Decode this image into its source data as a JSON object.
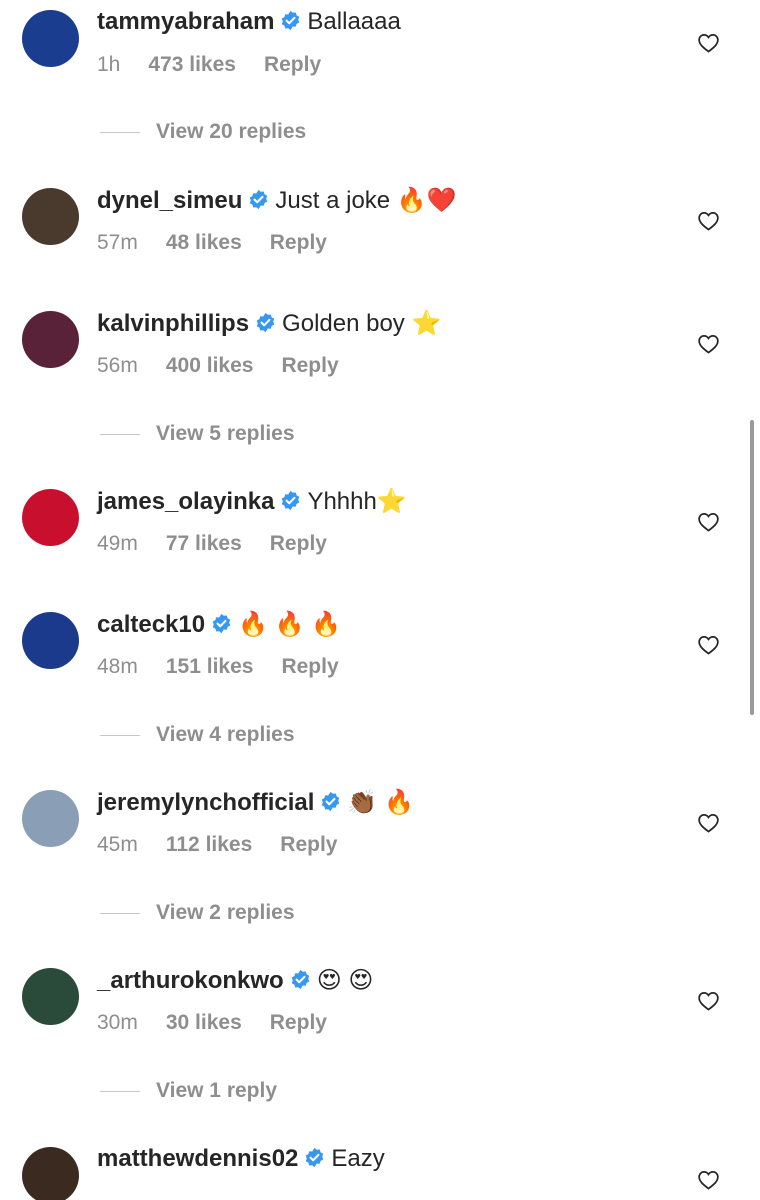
{
  "comments": [
    {
      "username": "tammyabraham",
      "text": "Ballaaaa",
      "time": "1h",
      "likes": "473 likes",
      "reply": "Reply",
      "avatar_color": "#1a3d8f"
    },
    {
      "username": "dynel_simeu",
      "text": "Just a joke 🔥❤️",
      "time": "57m",
      "likes": "48 likes",
      "reply": "Reply",
      "avatar_color": "#4a3a2e"
    },
    {
      "username": "kalvinphillips",
      "text": "Golden boy ⭐",
      "time": "56m",
      "likes": "400 likes",
      "reply": "Reply",
      "avatar_color": "#5a2238"
    },
    {
      "username": "james_olayinka",
      "text": "Yhhhh⭐",
      "time": "49m",
      "likes": "77 likes",
      "reply": "Reply",
      "avatar_color": "#c8102e"
    },
    {
      "username": "calteck10",
      "text": "🔥 🔥 🔥",
      "time": "48m",
      "likes": "151 likes",
      "reply": "Reply",
      "avatar_color": "#1b3a8c"
    },
    {
      "username": "jeremylynchofficial",
      "text": "👏🏾 🔥",
      "time": "45m",
      "likes": "112 likes",
      "reply": "Reply",
      "avatar_color": "#8a9fb5"
    },
    {
      "username": "_arthurokonkwo",
      "text": "😍 😍",
      "time": "30m",
      "likes": "30 likes",
      "reply": "Reply",
      "avatar_color": "#2a4a3a"
    },
    {
      "username": "matthewdennis02",
      "text": "Eazy",
      "time": "",
      "likes": "",
      "reply": "",
      "avatar_color": "#3a2a20"
    }
  ],
  "view_replies": [
    "View 20 replies",
    "View 5 replies",
    "View 4 replies",
    "View 2 replies",
    "View 1 reply"
  ],
  "colors": {
    "verified": "#3897f0",
    "muted": "#8e8e8e",
    "text": "#262626"
  },
  "icons": {
    "verified": "verified-badge-icon",
    "like": "heart-icon"
  }
}
